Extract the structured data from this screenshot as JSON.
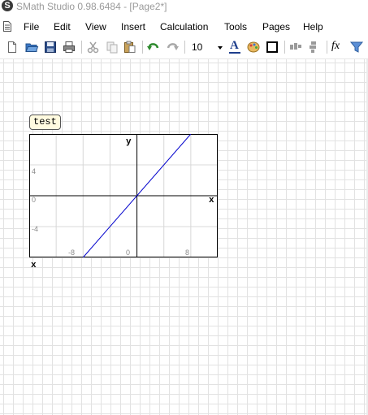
{
  "window": {
    "title": "SMath Studio 0.98.6484 - [Page2*]",
    "logo_letter": "S"
  },
  "menu": {
    "items": [
      "File",
      "Edit",
      "View",
      "Insert",
      "Calculation",
      "Tools",
      "Pages",
      "Help"
    ]
  },
  "toolbar": {
    "buttons": [
      "new-icon",
      "open-icon",
      "save-icon",
      "print-icon",
      "cut-icon",
      "copy-icon",
      "paste-icon",
      "undo-icon",
      "redo-icon"
    ],
    "font_size": "10",
    "right_buttons": [
      "font-color-icon",
      "fill-color-icon",
      "border-icon",
      "align-horizontal-icon",
      "align-vertical-icon",
      "function-icon",
      "filter-icon"
    ],
    "function_label": "fx",
    "font_icon_letter": "A"
  },
  "worksheet": {
    "region_label": "test",
    "plot": {
      "y_label": "y",
      "x_label": "x",
      "variable_label": "x",
      "y_ticks": [
        "4",
        "0",
        "-4"
      ],
      "x_ticks": [
        "-8",
        "0",
        "8"
      ]
    }
  },
  "chart_data": {
    "type": "line",
    "series": [
      {
        "values_x": [
          -8,
          8
        ],
        "values_y": [
          -8,
          8
        ],
        "color": "#0000cc"
      }
    ],
    "xlim": [
      -16,
      12
    ],
    "ylim": [
      -8,
      8
    ],
    "xlabel": "x",
    "ylabel": "y",
    "grid": true
  }
}
